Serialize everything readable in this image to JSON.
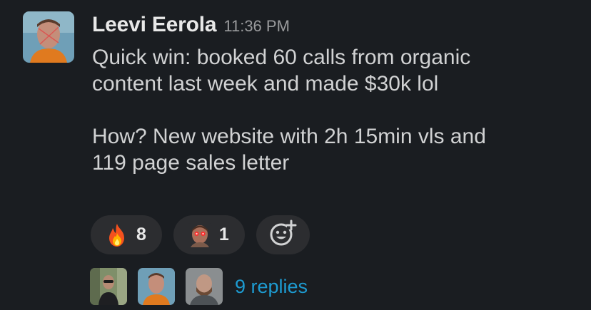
{
  "message": {
    "author": "Leevi Eerola",
    "timestamp": "11:36 PM",
    "lines": [
      "Quick win: booked 60 calls from organic",
      "content last week and made $30k lol",
      "How? New website with 2h 15min vls and",
      "119 page sales letter"
    ]
  },
  "reactions": [
    {
      "emoji": "fire-emoji",
      "count": "8"
    },
    {
      "emoji": "glowing-eyes-face-emoji",
      "count": "1"
    }
  ],
  "add_reaction": {
    "icon": "add-reaction-icon"
  },
  "thread": {
    "replies_label": "9 replies"
  },
  "colors": {
    "background": "#1a1d21",
    "text": "#d1d2d3",
    "link": "#1d9bd1",
    "pill": "#2c2d30",
    "timestamp": "#9a9b9d"
  }
}
